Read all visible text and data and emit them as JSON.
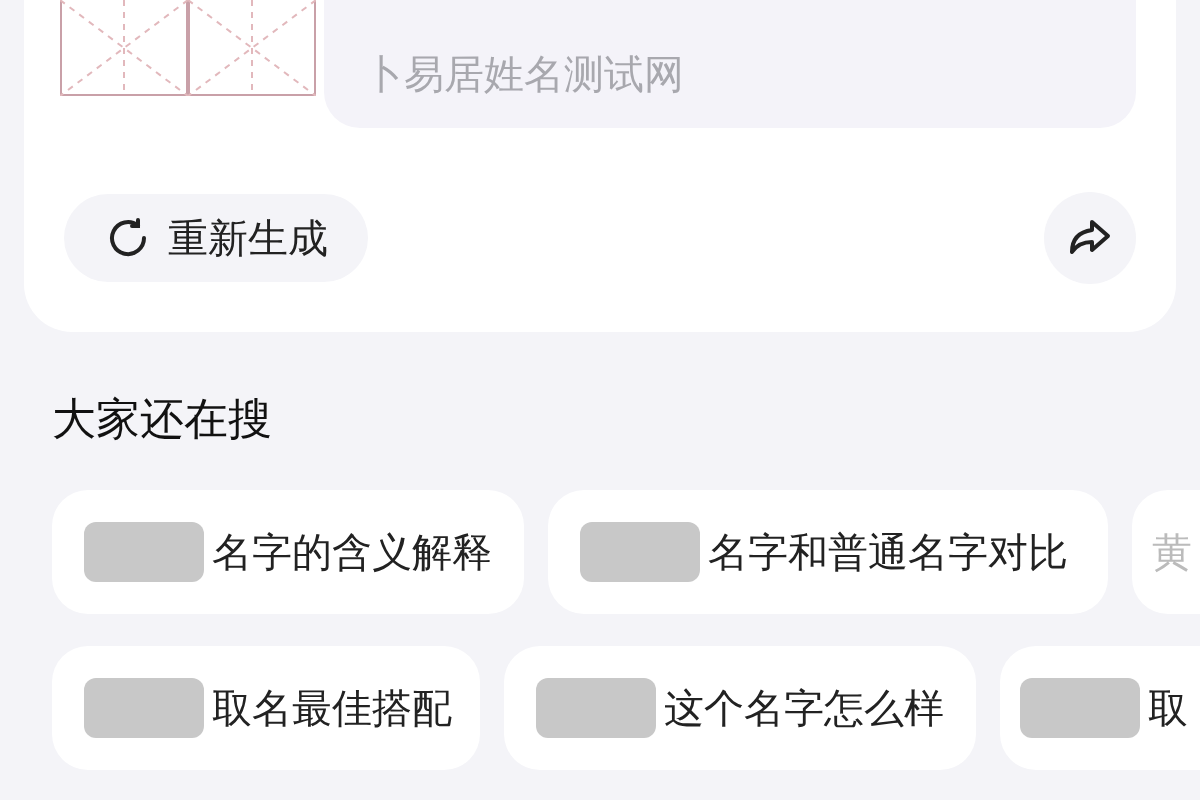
{
  "name_card": {
    "source_text": "卜易居姓名测试网",
    "regenerate_button": "重新生成"
  },
  "section_title": "大家还在搜",
  "suggestion_rows": [
    [
      {
        "text": "名字的含义解释",
        "redacted": true
      },
      {
        "text": "名字和普通名字对比",
        "redacted": true
      },
      {
        "text": "黄",
        "redacted": false
      }
    ],
    [
      {
        "text": "取名最佳搭配",
        "redacted": true
      },
      {
        "text": "这个名字怎么样",
        "redacted": true
      },
      {
        "text": "取",
        "redacted": true
      }
    ]
  ]
}
